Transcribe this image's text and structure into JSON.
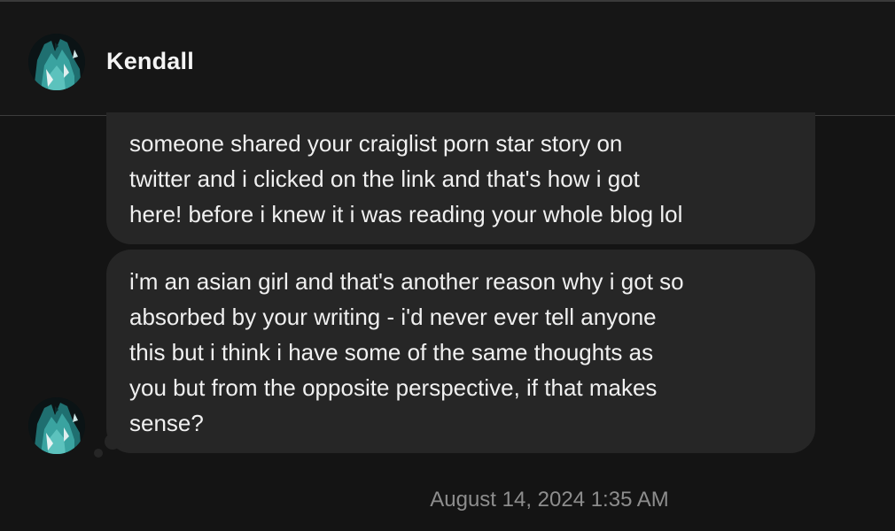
{
  "conversation": {
    "contact_name": "Kendall",
    "messages": [
      {
        "lines": [
          "someone shared your craiglist porn star story on",
          "twitter and i clicked on the link and that's how i got",
          "here! before i knew it i was reading your whole blog lol"
        ]
      },
      {
        "lines": [
          "i'm an asian girl and that's another reason why i got so",
          "absorbed by your writing - i'd never ever tell anyone",
          "this but i think i have some of the same thoughts as",
          "you but from the opposite perspective, if that makes",
          "sense?"
        ]
      }
    ],
    "timestamp": "August 14, 2024 1:35 AM"
  },
  "colors": {
    "background": "#141414",
    "bubble": "#262626",
    "text": "#f0f0f0",
    "timestamp_text": "#8d8d8d",
    "avatar_teal": "#2f8f8c"
  },
  "icons": {
    "header_avatar": "profile-photo-icon",
    "message_avatar": "profile-photo-icon"
  }
}
